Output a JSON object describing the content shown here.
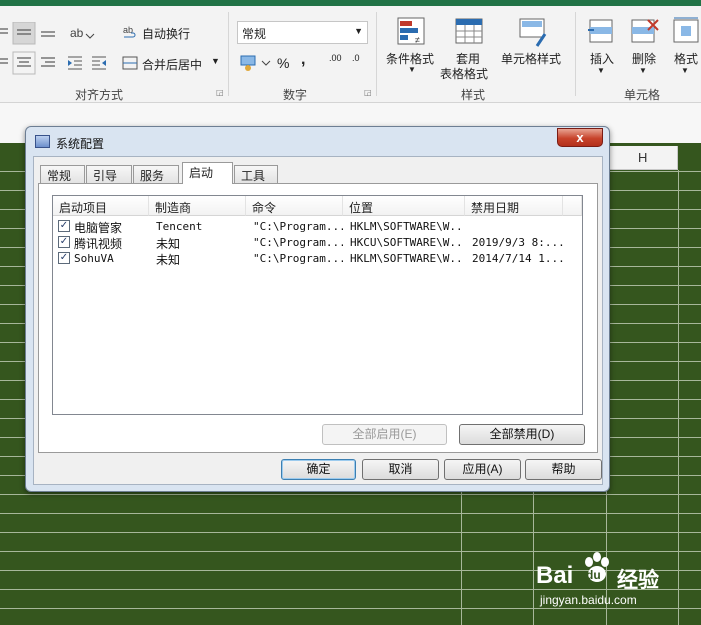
{
  "ribbon": {
    "wrap_text": "自动换行",
    "merge_center": "合并后居中",
    "alignment_group": "对齐方式",
    "number_format": "常规",
    "percent": "%",
    "comma": ",",
    "dec_increase": ".00",
    "dec_decrease": ".0",
    "number_group": "数字",
    "cond_format": "条件格式",
    "table_format_1": "套用",
    "table_format_2": "表格格式",
    "cell_style": "单元格样式",
    "styles_group": "样式",
    "insert": "插入",
    "delete": "删除",
    "format": "格式",
    "cells_group": "单元格"
  },
  "sheet": {
    "column_label": "H"
  },
  "dialog": {
    "title": "系统配置",
    "close": "x",
    "tabs": [
      {
        "label": "常规",
        "active": false
      },
      {
        "label": "引导",
        "active": false
      },
      {
        "label": "服务",
        "active": false
      },
      {
        "label": "启动",
        "active": true
      },
      {
        "label": "工具",
        "active": false
      }
    ],
    "columns": [
      "启动项目",
      "制造商",
      "命令",
      "位置",
      "禁用日期"
    ],
    "rows": [
      {
        "checked": true,
        "name": "电脑管家",
        "maker": "Tencent",
        "command": "\"C:\\Program...",
        "location": "HKLM\\SOFTWARE\\W...",
        "date": ""
      },
      {
        "checked": true,
        "name": "腾讯视频",
        "maker": "未知",
        "command": "\"C:\\Program...",
        "location": "HKCU\\SOFTWARE\\W...",
        "date": "2019/9/3 8:..."
      },
      {
        "checked": true,
        "name": "SohuVA",
        "maker": "未知",
        "command": "\"C:\\Program...",
        "location": "HKLM\\SOFTWARE\\W...",
        "date": "2014/7/14 1..."
      }
    ],
    "enable_all": "全部启用(E)",
    "disable_all": "全部禁用(D)",
    "ok": "确定",
    "cancel": "取消",
    "apply": "应用(A)",
    "help": "帮助"
  },
  "watermark": {
    "brand": "Bai",
    "brand2": "du",
    "site_cn": "经验",
    "url": "jingyan.baidu.com"
  },
  "colors": {
    "excel_green": "#217346",
    "sheet_fill": "#35561e",
    "dialog_frame": "#d9e4f1",
    "close_red": "#c7432b"
  }
}
